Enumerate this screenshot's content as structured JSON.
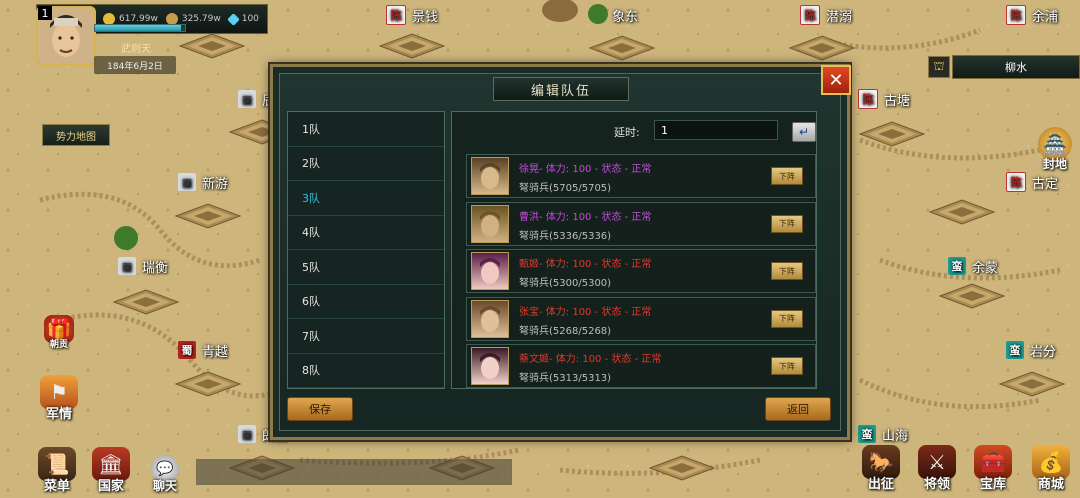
{
  "player": {
    "level": "1",
    "gold": "617.99w",
    "food": "325.79w",
    "diamonds": "100",
    "name": "武则天",
    "date": "184年6月2日",
    "hp_fraction": 0.95
  },
  "map": {
    "power_map_label": "势力地图",
    "location_name": "柳水",
    "cities": [
      {
        "badge": "陈",
        "badge_style": "chen",
        "name": "景钱"
      },
      {
        "badge": "",
        "badge_style": "none",
        "name": "象东"
      },
      {
        "badge": "陈",
        "badge_style": "chen",
        "name": "潜溺"
      },
      {
        "badge": "陈",
        "badge_style": "chen",
        "name": "余浦"
      },
      {
        "badge": "",
        "badge_style": "gray",
        "name": "辰"
      },
      {
        "badge": "陈",
        "badge_style": "chen",
        "name": "古塘"
      },
      {
        "badge": "",
        "badge_style": "gray",
        "name": "新游"
      },
      {
        "badge": "陈",
        "badge_style": "chen",
        "name": "古定"
      },
      {
        "badge": "",
        "badge_style": "gray",
        "name": "瑞衡"
      },
      {
        "badge": "蛮",
        "badge_style": "man",
        "name": "余蒙"
      },
      {
        "badge": "蜀",
        "badge_style": "shu",
        "name": "青越"
      },
      {
        "badge": "蛮",
        "badge_style": "man",
        "name": "岩分"
      },
      {
        "badge": "",
        "badge_style": "gray",
        "name": "朗吕"
      },
      {
        "badge": "蛮",
        "badge_style": "man",
        "name": "山海"
      }
    ]
  },
  "side_buttons": {
    "fief": "封地",
    "pay_tribute": "朝贡",
    "military_info": "军情"
  },
  "bottom_menu": {
    "menu": "菜单",
    "country": "国家",
    "chat": "聊天",
    "march": "出征",
    "generals": "将领",
    "treasury": "宝库",
    "shop": "商城"
  },
  "dialog": {
    "title": "编辑队伍",
    "close_label": "✕",
    "teams": [
      "1队",
      "2队",
      "3队",
      "4队",
      "5队",
      "6队",
      "7队",
      "8队"
    ],
    "active_team_index": 2,
    "delay_label": "延时:",
    "delay_value": "1",
    "generals": [
      {
        "name": "徐晃",
        "stats": "- 体力: 100 - 状态 - 正常",
        "troops": "弩骑兵(5705/5705)",
        "color": "#c34bd9",
        "dismiss": "下阵"
      },
      {
        "name": "曹洪",
        "stats": "- 体力: 100 - 状态 - 正常",
        "troops": "弩骑兵(5336/5336)",
        "color": "#c34bd9",
        "dismiss": "下阵"
      },
      {
        "name": "甄姬",
        "stats": "- 体力: 100 - 状态 - 正常",
        "troops": "弩骑兵(5300/5300)",
        "color": "#e23a2c",
        "dismiss": "下阵"
      },
      {
        "name": "张宝",
        "stats": "- 体力: 100 - 状态 - 正常",
        "troops": "弩骑兵(5268/5268)",
        "color": "#e23a2c",
        "dismiss": "下阵"
      },
      {
        "name": "蔡文姬",
        "stats": "- 体力: 100 - 状态 - 正常",
        "troops": "弩骑兵(5313/5313)",
        "color": "#e23a2c",
        "dismiss": "下阵"
      }
    ],
    "save_label": "保存",
    "back_label": "返回"
  }
}
